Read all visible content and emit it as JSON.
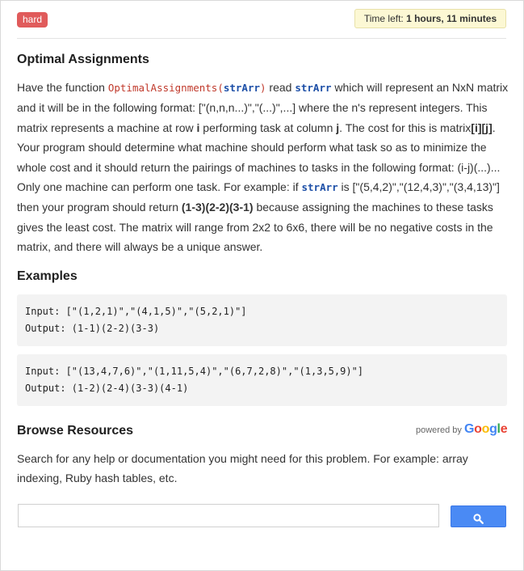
{
  "difficulty_badge": "hard",
  "timer": {
    "label": "Time left:",
    "value": "1 hours, 11 minutes"
  },
  "problem": {
    "title": "Optimal Assignments",
    "parts": {
      "p1": "Have the function ",
      "func": "OptimalAssignments(",
      "arg1": "strArr",
      "paren": ")",
      "p2": " read ",
      "arg2": "strArr",
      "p3": " which will represent an NxN matrix and it will be in the following format: [\"(n,n,n...)\",\"(...)\",...] where the n's represent integers. This matrix represents a machine at row ",
      "b_i": "i",
      "p4": " performing task at column ",
      "b_j": "j",
      "p5": ". The cost for this is matrix",
      "b_ij": "[i][j]",
      "p6": ". Your program should determine what machine should perform what task so as to minimize the whole cost and it should return the pairings of machines to tasks in the following format: (i-j)(...)... Only one machine can perform one task. For example: if ",
      "arg3": "strArr",
      "p7": " is [\"(5,4,2)\",\"(12,4,3)\",\"(3,4,13)\"] then your program should return ",
      "b_ans": "(1-3)(2-2)(3-1)",
      "p8": " because assigning the machines to these tasks gives the least cost. The matrix will range from 2x2 to 6x6, there will be no negative costs in the matrix, and there will always be a unique answer."
    }
  },
  "examples": {
    "title": "Examples",
    "items": [
      {
        "input": "Input: [\"(1,2,1)\",\"(4,1,5)\",\"(5,2,1)\"]",
        "output": "Output: (1-1)(2-2)(3-3)"
      },
      {
        "input": "Input: [\"(13,4,7,6)\",\"(1,11,5,4)\",\"(6,7,2,8)\",\"(1,3,5,9)\"]",
        "output": "Output: (1-2)(2-4)(3-3)(4-1)"
      }
    ]
  },
  "resources": {
    "title": "Browse Resources",
    "powered_by": "powered by",
    "google": [
      "G",
      "o",
      "o",
      "g",
      "l",
      "e"
    ],
    "text": "Search for any help or documentation you might need for this problem. For example: array indexing, Ruby hash tables, etc.",
    "search_value": "",
    "search_icon": "search-icon"
  }
}
